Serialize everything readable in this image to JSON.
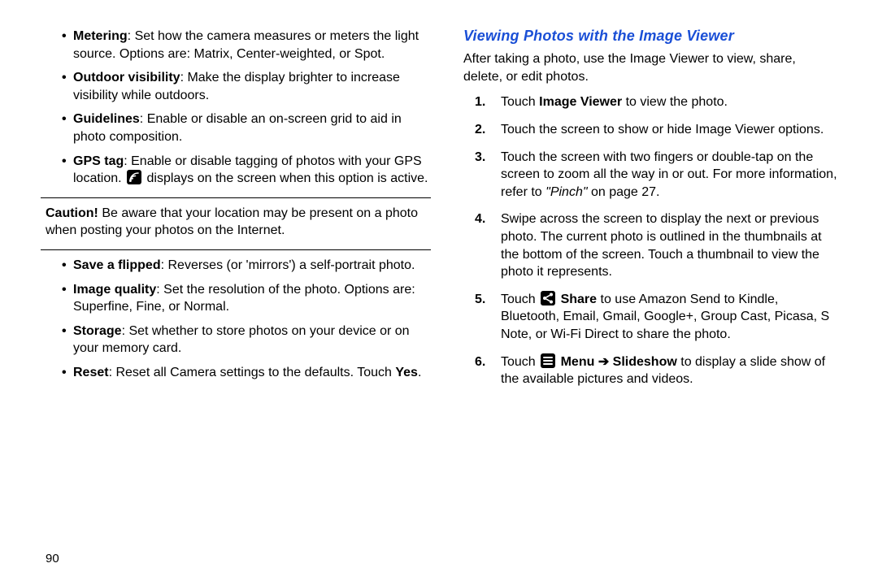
{
  "pageNumber": "90",
  "left": {
    "bullets1": [
      {
        "term": "Metering",
        "text": ": Set how the camera measures or meters the light source. Options are: Matrix, Center-weighted, or Spot."
      },
      {
        "term": "Outdoor visibility",
        "text": ": Make the display brighter to increase visibility while outdoors."
      },
      {
        "term": "Guidelines",
        "text": ": Enable or disable an on-screen grid to aid in photo composition."
      },
      {
        "term": "GPS tag",
        "pre": ": Enable or disable tagging of photos with your GPS location. ",
        "post": " displays on the screen when this option is active."
      }
    ],
    "cautionLabel": "Caution!",
    "cautionText": " Be aware that your location may be present on a photo when posting your photos on the Internet.",
    "bullets2": [
      {
        "term": "Save a flipped",
        "text": ": Reverses (or 'mirrors') a self-portrait photo."
      },
      {
        "term": "Image quality",
        "text": ": Set the resolution of the photo. Options are: Superfine, Fine, or Normal."
      },
      {
        "term": "Storage",
        "text": ": Set whether to store photos on your device or on your memory card."
      },
      {
        "term": "Reset",
        "pre": ": Reset all Camera settings to the defaults. Touch ",
        "boldTail": "Yes",
        "post": "."
      }
    ]
  },
  "right": {
    "heading": "Viewing Photos with the Image Viewer",
    "intro": "After taking a photo, use the Image Viewer to view, share, delete, or edit photos.",
    "steps": [
      {
        "n": "1.",
        "pre": "Touch ",
        "bold": "Image Viewer",
        "post": " to view the photo."
      },
      {
        "n": "2.",
        "text": "Touch the screen to show or hide Image Viewer options."
      },
      {
        "n": "3.",
        "pre": "Touch the screen with two fingers or double-tap on the screen to zoom all the way in or out. For more information, refer to ",
        "ital": "\"Pinch\"",
        "post": "  on page 27."
      },
      {
        "n": "4.",
        "text": "Swipe across the screen to display the next or previous photo. The current photo is outlined in the thumbnails at the bottom of the screen. Touch a thumbnail to view the photo it represents."
      },
      {
        "n": "5.",
        "pre": "Touch ",
        "icon": "share",
        "bold": " Share",
        "post": " to use Amazon Send to Kindle, Bluetooth, Email, Gmail, Google+, Group Cast, Picasa, S Note, or Wi-Fi Direct to share the photo."
      },
      {
        "n": "6.",
        "pre": "Touch ",
        "icon": "menu",
        "bold": " Menu ",
        "arrow": "➔",
        "bold2": " Slideshow",
        "post": " to display a slide show of the available pictures and videos."
      }
    ]
  }
}
